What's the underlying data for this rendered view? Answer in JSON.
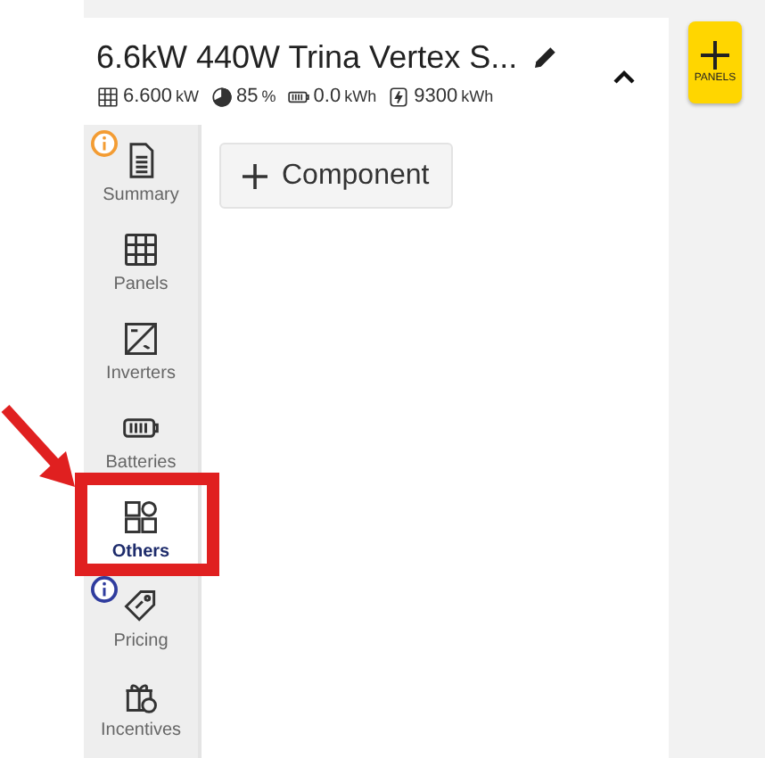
{
  "header": {
    "title": "6.6kW 440W Trina Vertex S...",
    "expanded": true,
    "stats": [
      {
        "kind": "panels",
        "value": "6.600",
        "unit": "kW"
      },
      {
        "kind": "offset",
        "value": "85",
        "unit": "%"
      },
      {
        "kind": "battery",
        "value": "0.0",
        "unit": "kWh"
      },
      {
        "kind": "energy",
        "value": "9300",
        "unit": "kWh"
      }
    ]
  },
  "sidebar": {
    "items": [
      {
        "kind": "summary",
        "label": "Summary",
        "selected": false,
        "color": "#f39c33"
      },
      {
        "kind": "panels",
        "label": "Panels",
        "selected": false
      },
      {
        "kind": "inverters",
        "label": "Inverters",
        "selected": false
      },
      {
        "kind": "batteries",
        "label": "Batteries",
        "selected": false
      },
      {
        "kind": "others",
        "label": "Others",
        "selected": true
      },
      {
        "kind": "pricing",
        "label": "Pricing",
        "selected": false,
        "color": "#2f3c9e"
      },
      {
        "kind": "incentives",
        "label": "Incentives",
        "selected": false
      }
    ]
  },
  "add_button": {
    "label": "Component"
  },
  "panels_button": {
    "label": "PANELS"
  }
}
